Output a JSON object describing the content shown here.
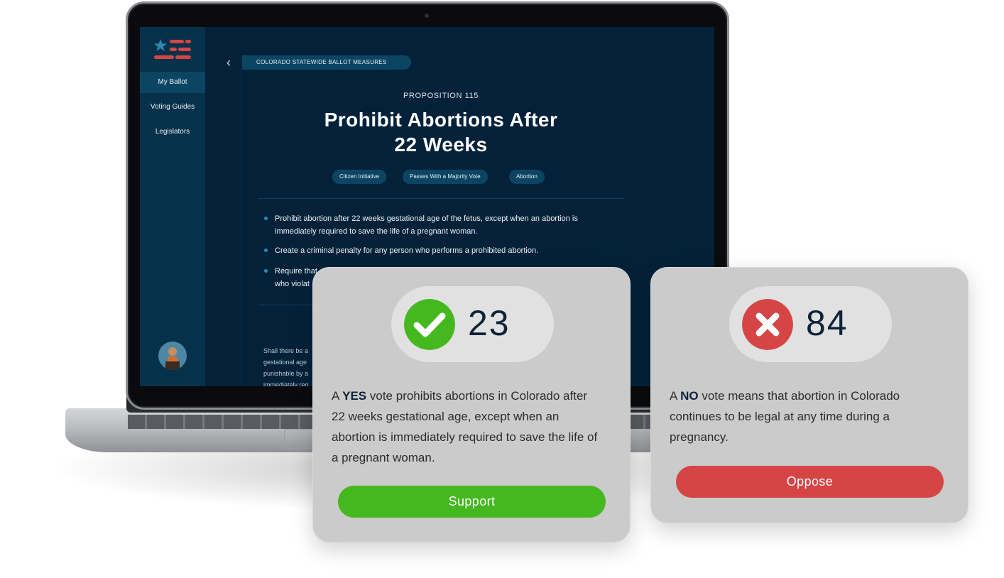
{
  "app": {
    "nav": [
      "My Ballot",
      "Voting Guides",
      "Legislators"
    ],
    "breadcrumb": "COLORADO STATEWIDE BALLOT MEASURES",
    "proposition": "PROPOSITION 115",
    "title_line1": "Prohibit Abortions After",
    "title_line2": "22 Weeks",
    "tags": [
      "Citizen Initiative",
      "Passes With a Majority Vote",
      "Abortion"
    ],
    "bullets": [
      "Prohibit abortion after 22 weeks gestational age of the fetus, except when an abortion is immediately required to save the life of a pregnant woman.",
      "Create a criminal penalty for any person who performs a prohibited abortion.",
      "Require that",
      "who violat"
    ],
    "fine_print": [
      "Shall there be a",
      "gestational age",
      "punishable by a",
      "immediately req"
    ]
  },
  "support_card": {
    "count": "23",
    "vote_word": "YES",
    "desc_line1_pre": "A ",
    "desc_line1_post": " vote prohibits abortions in Colorado after",
    "desc_line2": "22 weeks gestational age, except when an",
    "desc_line3": "abortion is immediately required to save the life of",
    "desc_line4": "a pregnant woman.",
    "button": "Support",
    "color": "#45b81f",
    "icon": "check-icon"
  },
  "oppose_card": {
    "count": "84",
    "vote_word": "NO",
    "desc_line1_pre": "A ",
    "desc_line1_post": " vote means that abortion in Colorado",
    "desc_line2": "continues to be legal at any time during a",
    "desc_line3": "pregnancy.",
    "button": "Oppose",
    "color": "#d64545",
    "icon": "x-icon"
  }
}
